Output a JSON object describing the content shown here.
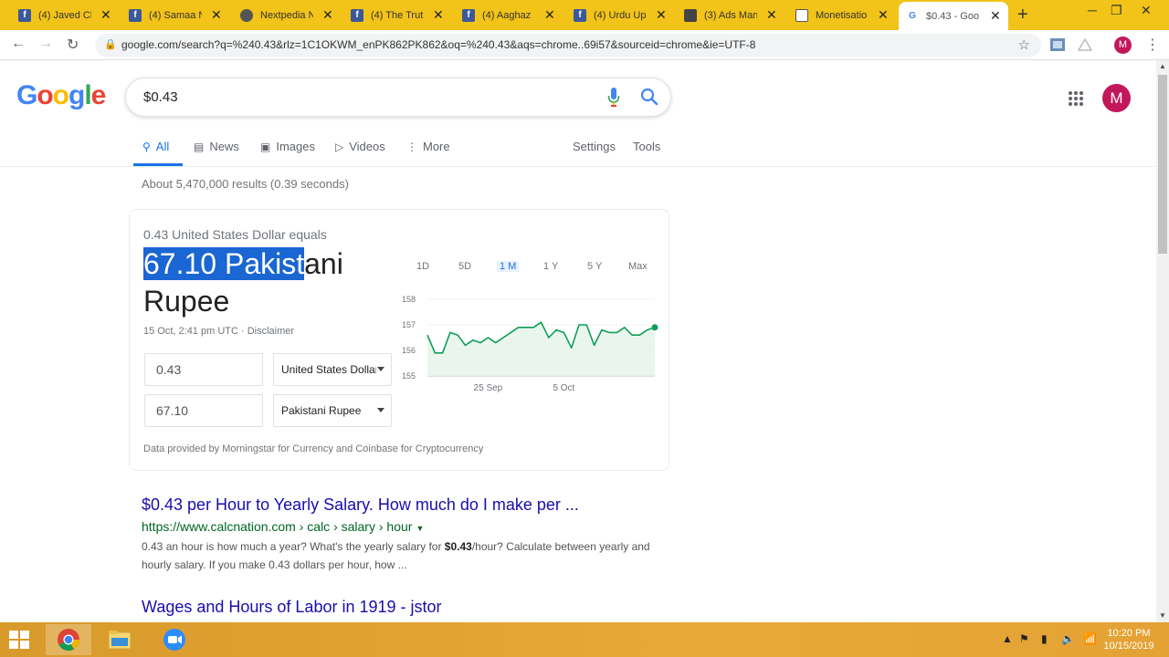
{
  "browser": {
    "tabs": [
      {
        "title": "(4) Javed Ch",
        "icon": "facebook-icon"
      },
      {
        "title": "(4) Samaa N",
        "icon": "facebook-icon"
      },
      {
        "title": "Nextpedia N",
        "icon": "globe-icon"
      },
      {
        "title": "(4) The Trut",
        "icon": "facebook-icon"
      },
      {
        "title": "(4) Aaghaz",
        "icon": "facebook-icon"
      },
      {
        "title": "(4) Urdu Up",
        "icon": "facebook-icon"
      },
      {
        "title": "(3) Ads Man",
        "icon": "ads-icon"
      },
      {
        "title": "Monetisatio",
        "icon": "page-icon"
      },
      {
        "title": "$0.43 - Goo",
        "icon": "google-icon",
        "active": true
      }
    ],
    "url": "google.com/search?q=%240.43&rlz=1C1OKWM_enPK862PK862&oq=%240.43&aqs=chrome..69i57&sourceid=chrome&ie=UTF-8",
    "profile_initial": "M"
  },
  "google": {
    "logo": "Google",
    "query": "$0.43",
    "avatar_initial": "M",
    "tabs": {
      "all": "All",
      "news": "News",
      "images": "Images",
      "videos": "Videos",
      "more": "More",
      "settings": "Settings",
      "tools": "Tools"
    },
    "stats": "About 5,470,000 results (0.39 seconds)"
  },
  "converter": {
    "equals_line": "0.43 United States Dollar equals",
    "result_selected": "67.10 Pakist",
    "result_rest": "ani Rupee",
    "updated": "15 Oct, 2:41 pm UTC · Disclaimer",
    "from_amount": "0.43",
    "from_currency": "United States Dollar",
    "to_amount": "67.10",
    "to_currency": "Pakistani Rupee",
    "source": "Data provided by Morningstar for Currency and Coinbase for Cryptocurrency",
    "ranges": [
      "1D",
      "5D",
      "1 M",
      "1 Y",
      "5 Y",
      "Max"
    ],
    "active_range": "1 M",
    "colors": {
      "line": "#0f9d58",
      "fill": "#e6f4ea"
    }
  },
  "chart_data": {
    "type": "area",
    "title": "",
    "xlabel": "",
    "ylabel": "",
    "ylim": [
      155,
      158
    ],
    "yticks": [
      155,
      156,
      157,
      158
    ],
    "xticks": [
      {
        "label": "25 Sep",
        "index": 8
      },
      {
        "label": "5 Oct",
        "index": 18
      }
    ],
    "grid": true,
    "values": [
      156.6,
      155.9,
      155.9,
      156.7,
      156.6,
      156.2,
      156.4,
      156.3,
      156.5,
      156.3,
      156.5,
      156.7,
      156.9,
      156.9,
      156.9,
      157.1,
      156.5,
      156.8,
      156.7,
      156.1,
      157.0,
      157.0,
      156.2,
      156.8,
      156.7,
      156.7,
      156.9,
      156.6,
      156.6,
      156.8,
      156.9
    ]
  },
  "results": [
    {
      "title": "$0.43 per Hour to Yearly Salary. How much do I make per ...",
      "url": "https://www.calcnation.com › calc › salary › hour",
      "snippet_a": "0.43 an hour is how much a year? What's the yearly salary for ",
      "snippet_bold": "$0.43",
      "snippet_b": "/hour? Calculate between yearly and hourly salary. If you make 0.43 dollars per hour, how ..."
    },
    {
      "title": "Wages and Hours of Labor in 1919 - jstor"
    }
  ],
  "taskbar": {
    "clock_time": "10:20 PM",
    "clock_date": "10/15/2019"
  }
}
